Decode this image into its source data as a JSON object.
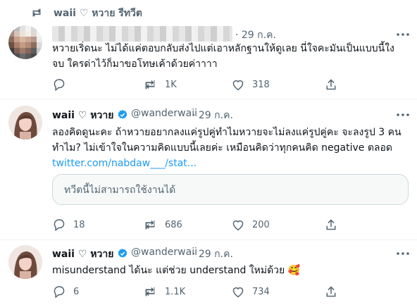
{
  "retweet_header": {
    "text": "waii ♡ หวาย รีทวีต"
  },
  "tweets": [
    {
      "name": "",
      "date": "· 29 ก.ค.",
      "text_lines": [
        "หวายเริ่ดนะ ไม่ได้แค่ตอบกลับส่งไปแต่เอาหลักฐานให้ดูเลย นี่ใจคะมันเป็นแบบนี้ใง",
        "จบ ใครด่าไว้ก็มาขอโทษเค้าด้วยค่าาาา"
      ],
      "actions": {
        "reply": "",
        "retweet": "1K",
        "like": "318"
      }
    },
    {
      "name": "waii ♡ หวาย",
      "handle": "@wanderwaii",
      "date": "· 29 ก.ค.",
      "text_lines": [
        "ลองคิดดูนะคะ ถ้าหวายอยากลงแค่รูปคู่ทำไมหวายจะไม่ลงแค่รูปคู่คะ จะลงรูป 3 คน",
        "ทำไม? ไม่เข้าใจในความคิดแบบนี้เลยค่ะ เหมือนคิดว่าทุกคนคิด negative ตลอด"
      ],
      "link": "twitter.com/nabdaw___/stat...",
      "quote_unavailable": "ทวีตนี้ไม่สามารถใช้งานได้",
      "actions": {
        "reply": "18",
        "retweet": "686",
        "like": "200"
      }
    },
    {
      "name": "waii ♡ หวาย",
      "handle": "@wanderwaii",
      "date": "· 29 ก.ค.",
      "text_lines": [
        "misunderstand ได้นะ แต่ช่วย understand ใหม่ด้วย 🥰"
      ],
      "actions": {
        "reply": "6",
        "retweet": "1.1K",
        "like": "734"
      }
    }
  ],
  "colors": {
    "accent": "#1d9bf0",
    "muted": "#536471",
    "text": "#0f1419"
  }
}
